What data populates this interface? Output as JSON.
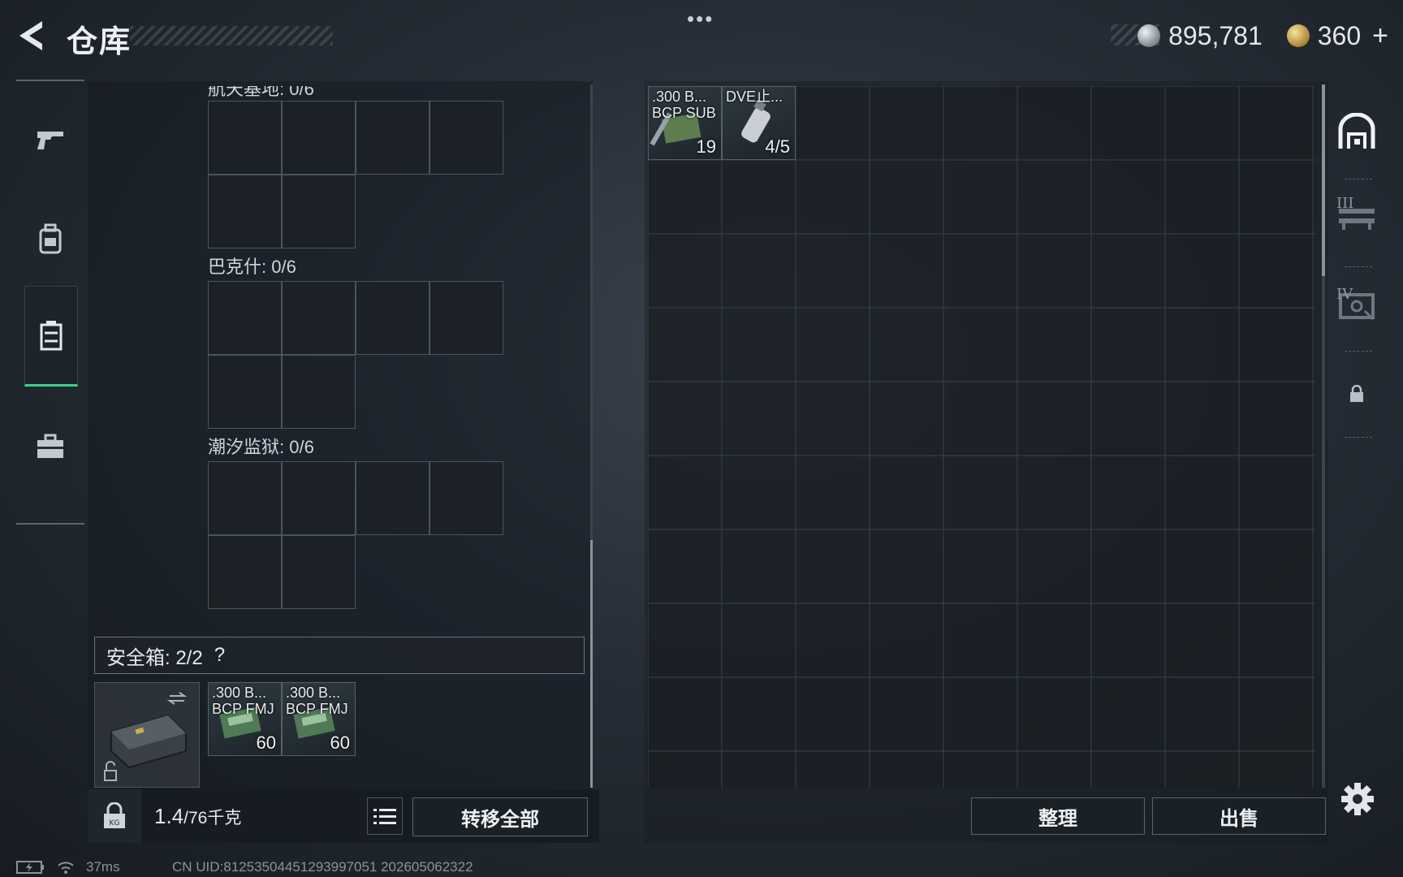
{
  "header": {
    "title": "仓库",
    "silver_amount": "895,781",
    "gold_amount": "360",
    "plus_label": "+",
    "menu_label": "•••"
  },
  "left_rail": {
    "items": [
      {
        "icon": "pistol-icon"
      },
      {
        "icon": "backpack-icon"
      },
      {
        "icon": "locker-icon",
        "active": true
      },
      {
        "icon": "toolbox-icon"
      }
    ]
  },
  "containers": [
    {
      "label": "航天基地: 0/6"
    },
    {
      "label": "巴克什: 0/6"
    },
    {
      "label": "潮汐监狱: 0/6"
    }
  ],
  "safe_box": {
    "header": "安全箱:  2/2",
    "help": "?",
    "items": [
      {
        "name1": ".300 B...",
        "name2": "BCP FMJ",
        "count": "60"
      },
      {
        "name1": ".300 B...",
        "name2": "BCP FMJ",
        "count": "60"
      }
    ]
  },
  "weight": {
    "current": "1.4",
    "max": "/76千克"
  },
  "buttons": {
    "transfer_all": "转移全部",
    "sort": "整理",
    "sell": "出售"
  },
  "stash": {
    "items": [
      {
        "name1": ".300 B...",
        "name2": "BCP SUB",
        "count": "19"
      },
      {
        "name1": "DVE止...",
        "name2": "",
        "count": "4/5"
      }
    ]
  },
  "right_rail": {
    "tab1_roman": "",
    "tab3_roman": "III",
    "tab4_roman": "IV"
  },
  "status": {
    "ping": "37ms",
    "uid": "CN UID:8125350445129399705‌1  202605062322"
  }
}
